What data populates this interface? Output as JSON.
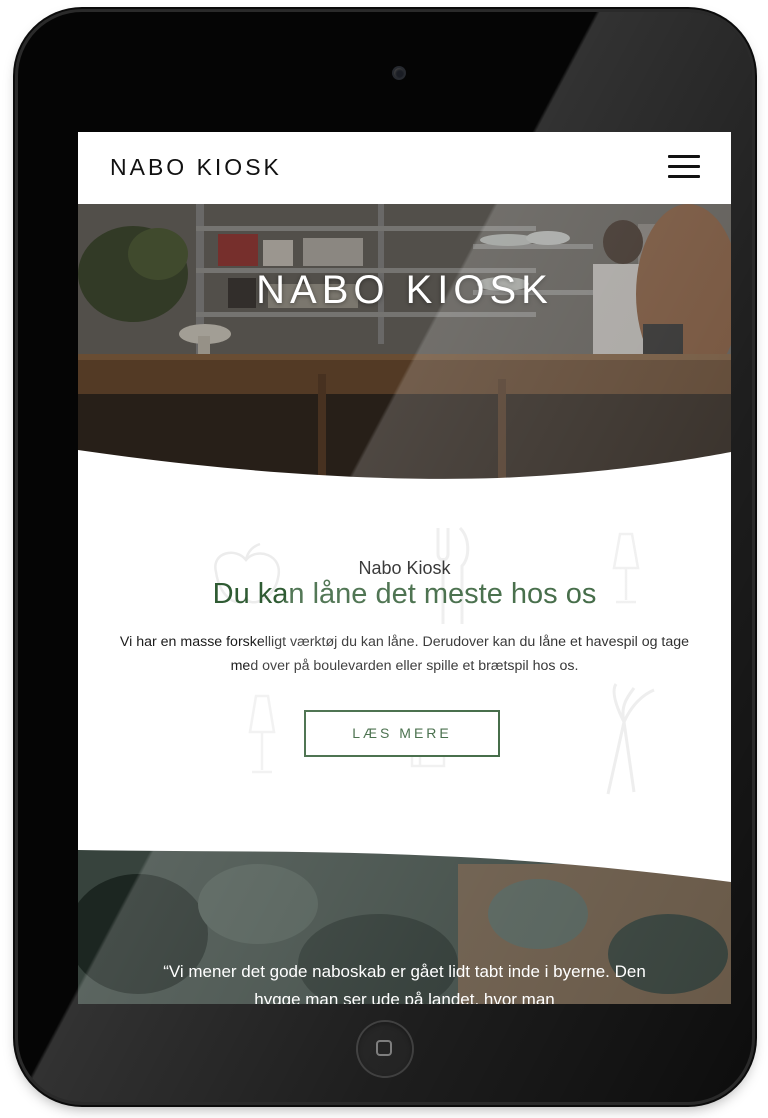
{
  "navbar": {
    "brand": "NABO KIOSK",
    "menu_icon": "hamburger-menu-icon"
  },
  "hero": {
    "title": "NABO KIOSK"
  },
  "intro": {
    "eyebrow": "Nabo Kiosk",
    "heading": "Du kan låne det meste hos os",
    "body": "Vi har en masse forskelligt værktøj du kan låne. Derudover kan du låne et havespil og tage med over på boulevarden eller spille et brætspil hos os.",
    "button_label": "LÆS MERE"
  },
  "quote": {
    "text": "“Vi mener det gode naboskab er gået lidt tabt inde i byerne. Den hygge man ser ude på landet, hvor man"
  },
  "colors": {
    "accent_green": "#2f5b33",
    "text": "#1c1c1c",
    "frame": "#050505"
  },
  "device": {
    "camera_icon": "camera-icon",
    "home_button_icon": "home-button-icon"
  }
}
